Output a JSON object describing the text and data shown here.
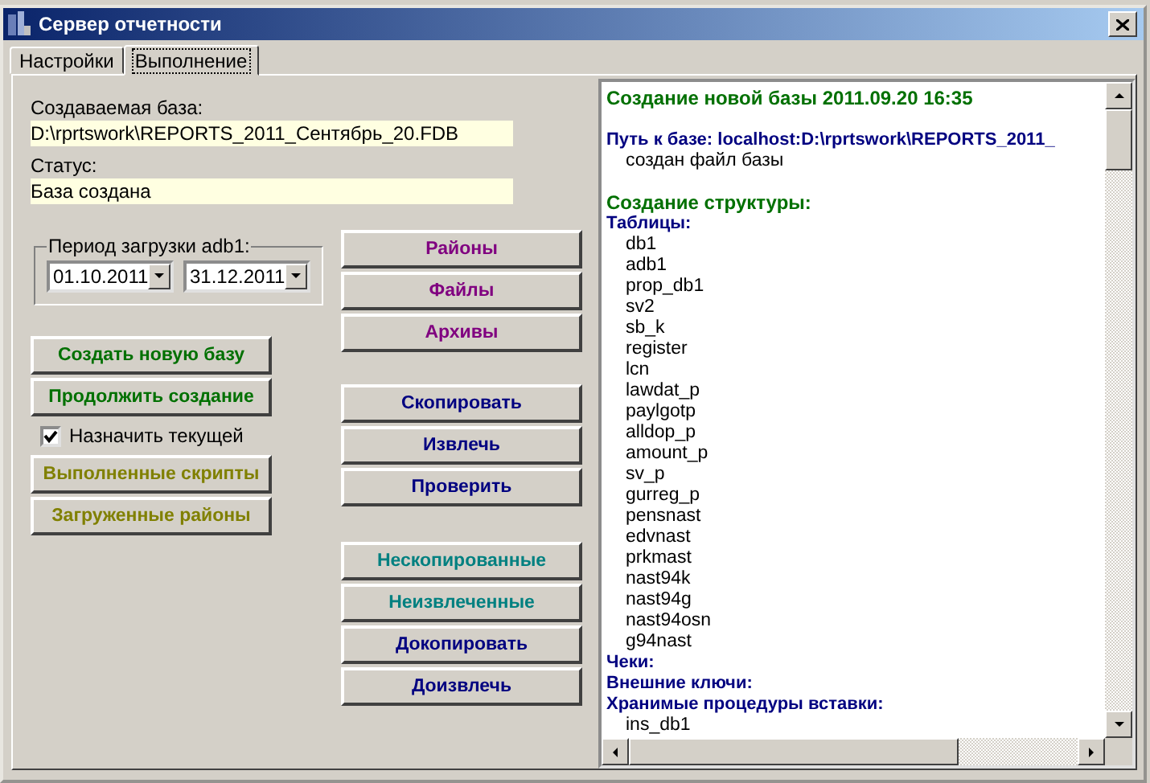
{
  "window": {
    "title": "Сервер отчетности"
  },
  "tabs": [
    {
      "label": "Настройки",
      "selected": false
    },
    {
      "label": "Выполнение",
      "selected": true
    }
  ],
  "database": {
    "label": "Создаваемая база:",
    "value": "D:\\rprtswork\\REPORTS_2011_Сентябрь_20.FDB"
  },
  "status": {
    "label": "Статус:",
    "value": "База создана"
  },
  "period": {
    "legend": "Период загрузки adb1:",
    "from": "01.10.2011",
    "to": "31.12.2011"
  },
  "create_buttons": [
    {
      "label": "Создать новую базу",
      "color": "#007000"
    },
    {
      "label": "Продолжить создание",
      "color": "#007000"
    }
  ],
  "set_current": {
    "label": "Назначить текущей",
    "checked": true
  },
  "report_buttons": [
    {
      "label": "Выполненные скрипты",
      "color": "#808000"
    },
    {
      "label": "Загруженные районы",
      "color": "#808000"
    }
  ],
  "list_buttons": [
    {
      "label": "Районы",
      "color": "#800080"
    },
    {
      "label": "Файлы",
      "color": "#800080"
    },
    {
      "label": "Архивы",
      "color": "#800080"
    }
  ],
  "action_buttons": [
    {
      "label": "Скопировать",
      "color": "#000080"
    },
    {
      "label": "Извлечь",
      "color": "#000080"
    },
    {
      "label": "Проверить",
      "color": "#000080"
    }
  ],
  "rest_buttons": [
    {
      "label": "Нескопированные",
      "color": "#008080"
    },
    {
      "label": "Неизвлеченные",
      "color": "#008080"
    },
    {
      "label": "Докопировать",
      "color": "#000080"
    },
    {
      "label": "Доизвлечь",
      "color": "#000080"
    }
  ],
  "log": [
    {
      "kind": "title",
      "text": "Создание новой базы 2011.09.20 16:35"
    },
    {
      "kind": "blank"
    },
    {
      "kind": "section",
      "text": "Путь к базе: localhost:D:\\rprtswork\\REPORTS_2011_"
    },
    {
      "kind": "item",
      "text": "создан файл базы"
    },
    {
      "kind": "blank"
    },
    {
      "kind": "title",
      "text": "Создание структуры:"
    },
    {
      "kind": "section",
      "text": "Таблицы:"
    },
    {
      "kind": "item",
      "text": "db1"
    },
    {
      "kind": "item",
      "text": "adb1"
    },
    {
      "kind": "item",
      "text": "prop_db1"
    },
    {
      "kind": "item",
      "text": "sv2"
    },
    {
      "kind": "item",
      "text": "sb_k"
    },
    {
      "kind": "item",
      "text": "register"
    },
    {
      "kind": "item",
      "text": "lcn"
    },
    {
      "kind": "item",
      "text": "lawdat_p"
    },
    {
      "kind": "item",
      "text": "paylgotp"
    },
    {
      "kind": "item",
      "text": "alldop_p"
    },
    {
      "kind": "item",
      "text": "amount_p"
    },
    {
      "kind": "item",
      "text": "sv_p"
    },
    {
      "kind": "item",
      "text": "gurreg_p"
    },
    {
      "kind": "item",
      "text": "pensnast"
    },
    {
      "kind": "item",
      "text": "edvnast"
    },
    {
      "kind": "item",
      "text": "prkmast"
    },
    {
      "kind": "item",
      "text": "nast94k"
    },
    {
      "kind": "item",
      "text": "nast94g"
    },
    {
      "kind": "item",
      "text": "nast94osn"
    },
    {
      "kind": "item",
      "text": "g94nast"
    },
    {
      "kind": "section",
      "text": "Чеки:"
    },
    {
      "kind": "section",
      "text": "Внешние ключи:"
    },
    {
      "kind": "section",
      "text": "Хранимые процедуры вставки:"
    },
    {
      "kind": "item",
      "text": "ins_db1"
    }
  ]
}
